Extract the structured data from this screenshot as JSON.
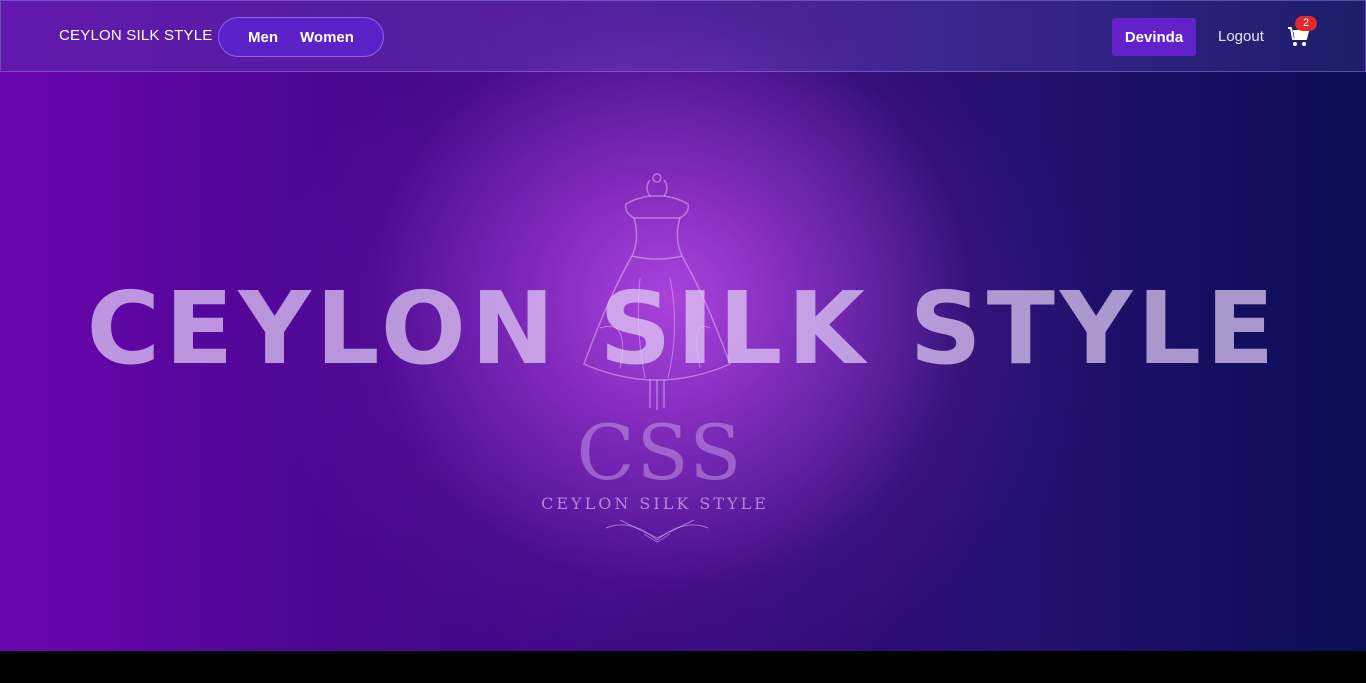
{
  "navbar": {
    "brand": "CEYLON SILK STYLE",
    "links": [
      "Men",
      "Women"
    ],
    "user_label": "Devinda",
    "logout_label": "Logout",
    "cart_count": "2",
    "cart_icon": "cart-icon"
  },
  "hero": {
    "headline": "CEYLON SILK STYLE",
    "logo_letters": "CSS",
    "logo_name": "CEYLON SILK STYLE"
  },
  "colors": {
    "nav_pill": "#5a22c8",
    "user_button": "#6321c9",
    "badge": "#e0282e",
    "hero_left": "#6a06b0",
    "hero_right": "#0b0d58"
  }
}
